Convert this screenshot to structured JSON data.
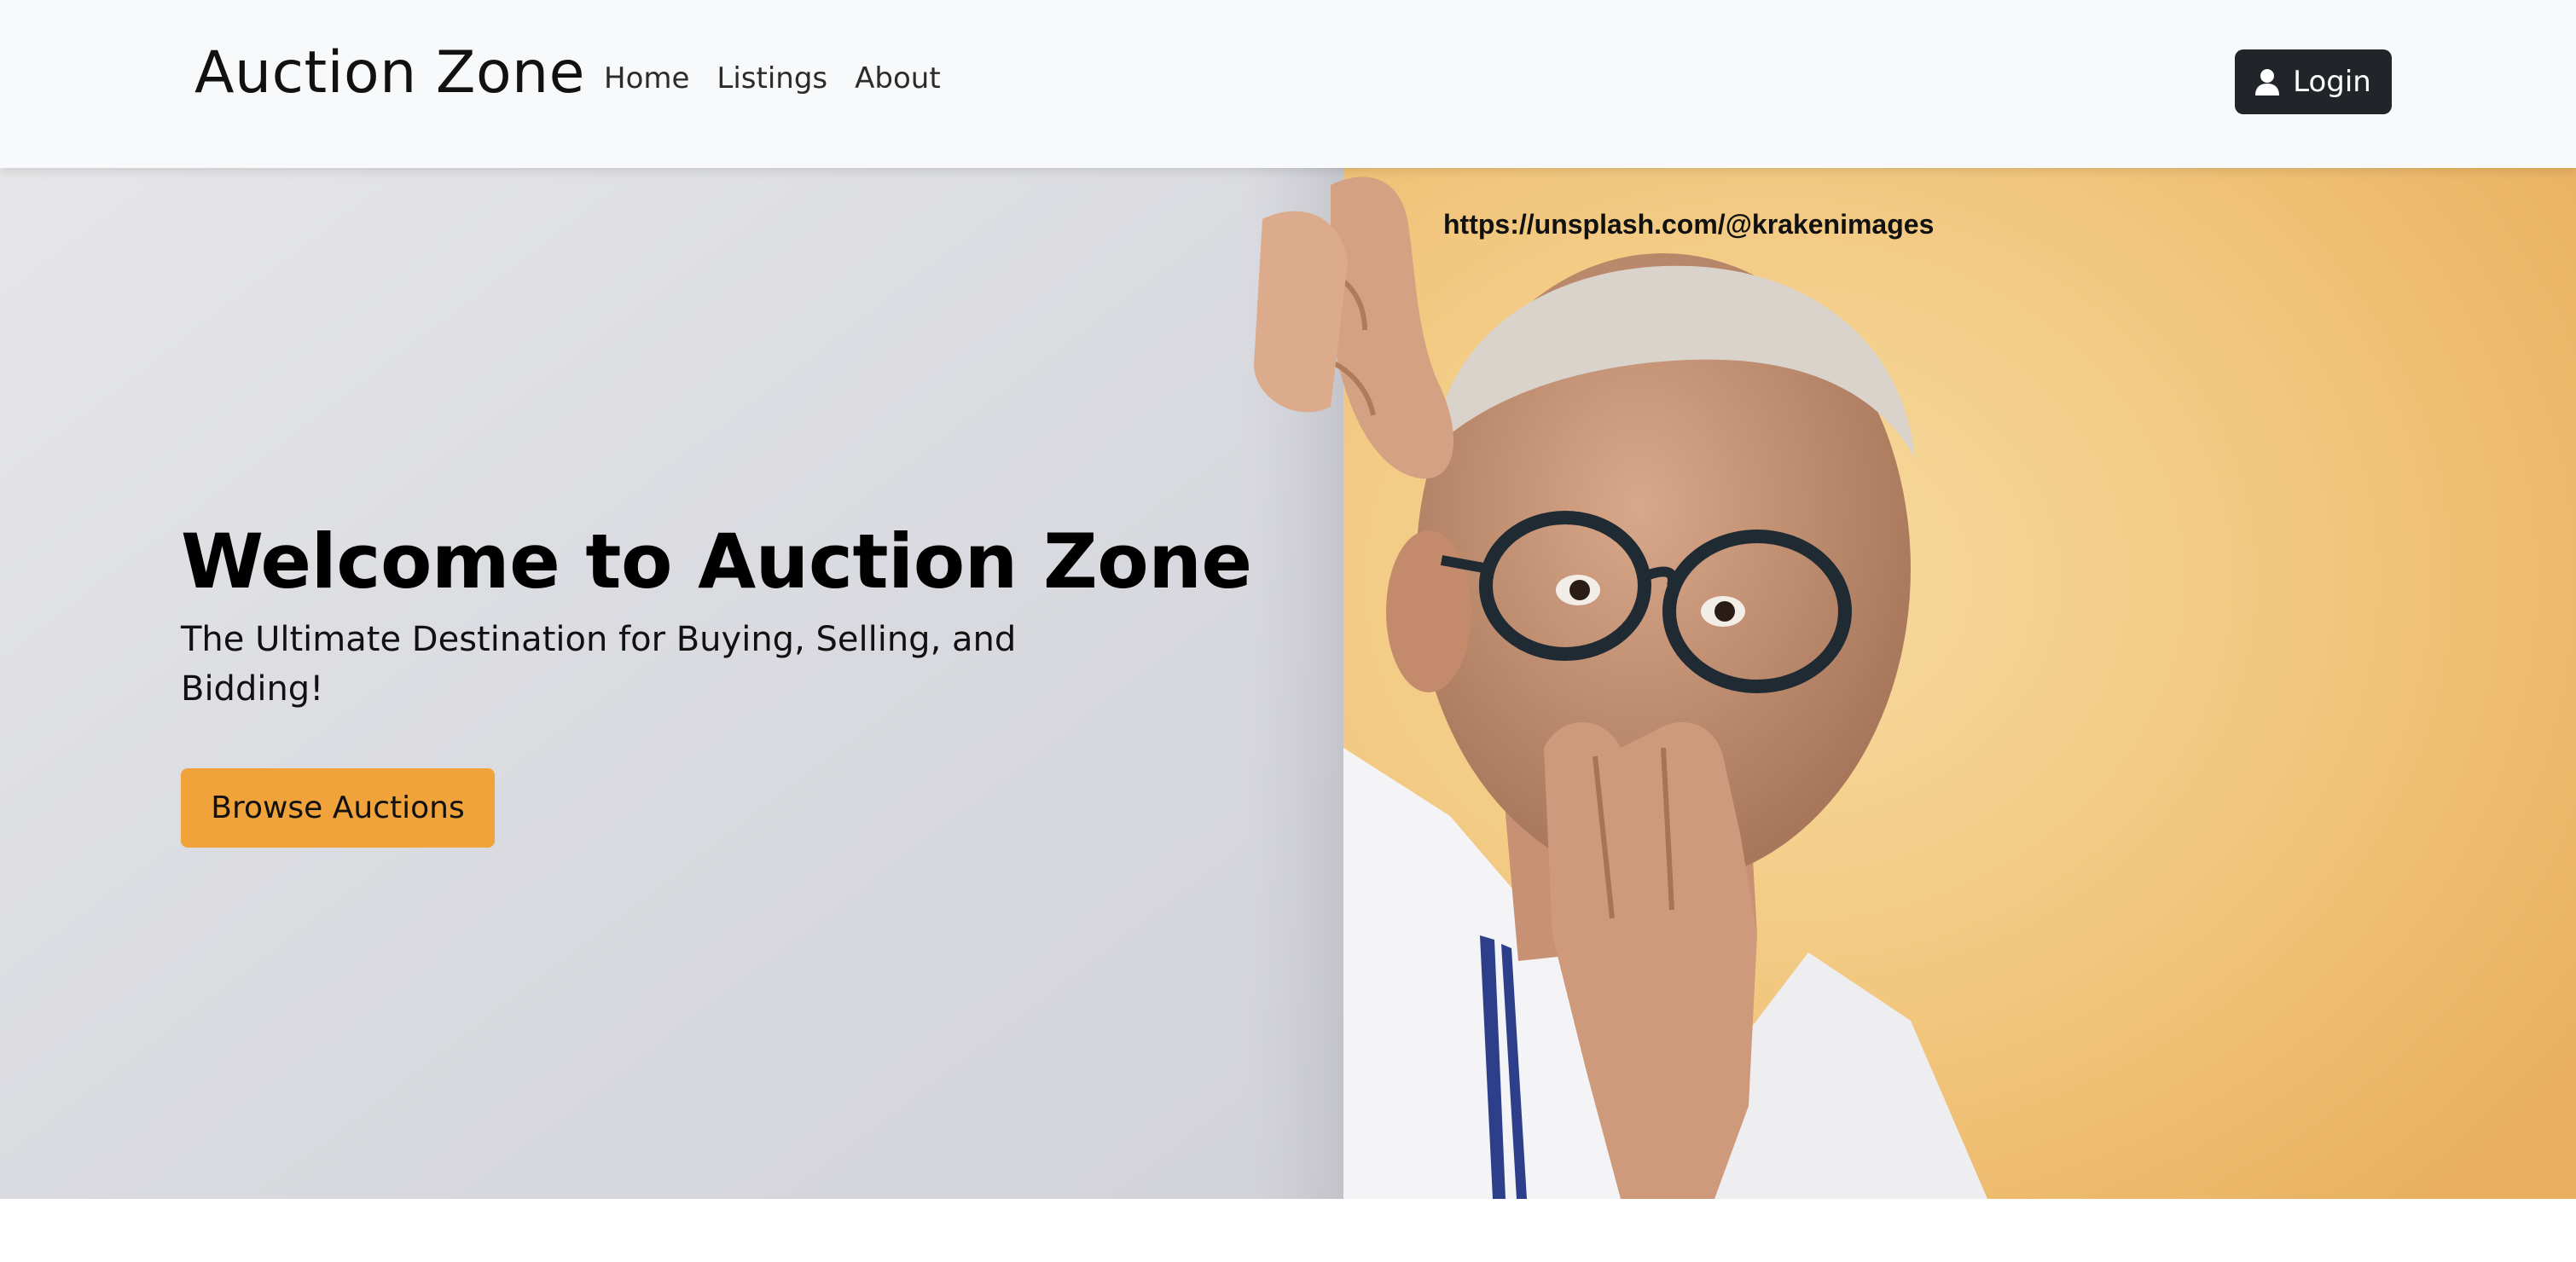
{
  "navbar": {
    "brand": "Auction Zone",
    "links": [
      {
        "label": "Home"
      },
      {
        "label": "Listings"
      },
      {
        "label": "About"
      }
    ],
    "login": {
      "label": "Login",
      "icon": "user-icon"
    },
    "background": "#f8f9fa"
  },
  "hero": {
    "photo_credit": "https://unsplash.com/@krakenimages",
    "title": "Welcome to Auction Zone",
    "subtitle": "The Ultimate Destination for Buying, Selling, and Bidding!",
    "cta": {
      "label": "Browse Auctions",
      "color": "#f0a33a"
    },
    "image_description_colors": {
      "left_wall": "#dcdde2",
      "right_backdrop": "#f2c57c"
    }
  }
}
